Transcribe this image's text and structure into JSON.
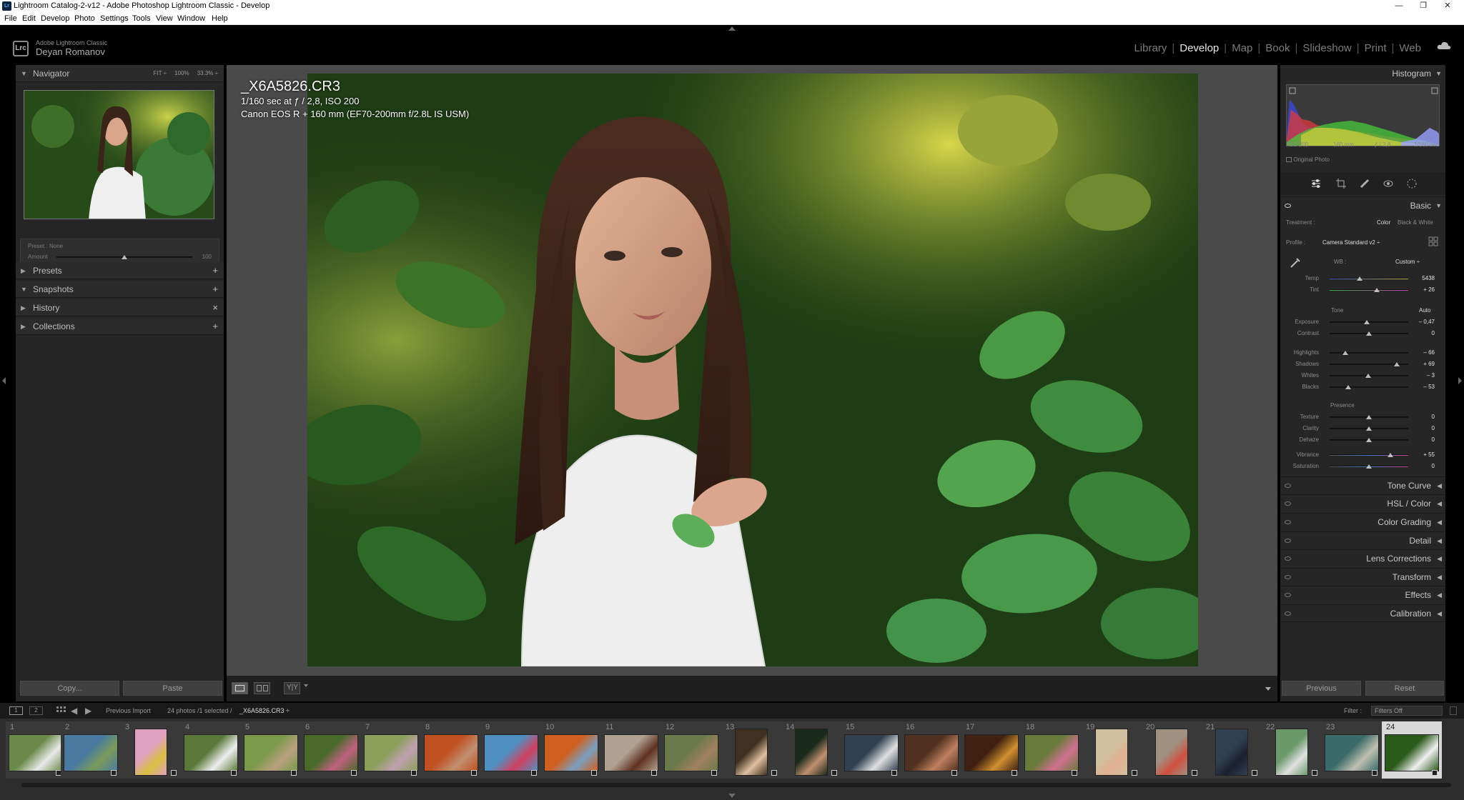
{
  "window": {
    "title": "Lightroom Catalog-2-v12 - Adobe Photoshop Lightroom Classic - Develop",
    "controls": [
      "—",
      "❐",
      "✕"
    ]
  },
  "menu": [
    "File",
    "Edit",
    "Develop",
    "Photo",
    "Settings",
    "Tools",
    "View",
    "Window",
    "Help"
  ],
  "brand": {
    "app": "Adobe Lightroom Classic",
    "user": "Deyan Romanov",
    "logo": "Lrc"
  },
  "modules": [
    "Library",
    "Develop",
    "Map",
    "Book",
    "Slideshow",
    "Print",
    "Web"
  ],
  "active_module": "Develop",
  "left": {
    "navigator": {
      "label": "Navigator",
      "fit": "FIT ÷",
      "z1": "100%",
      "z2": "33.3% ÷"
    },
    "preset_row": {
      "preset_label": "Preset :",
      "preset_value": "None",
      "amount_label": "Amount",
      "amount_value": "100"
    },
    "sections": [
      {
        "label": "Presets",
        "action": "+"
      },
      {
        "label": "Snapshots",
        "action": "+"
      },
      {
        "label": "History",
        "action": "×"
      },
      {
        "label": "Collections",
        "action": "+"
      }
    ],
    "copy": "Copy...",
    "paste": "Paste"
  },
  "photo_info": {
    "filename": "_X6A5826.CR3",
    "exposure": "1/160 sec at ƒ / 2,8, ISO 200",
    "camera": "Canon EOS R + 160 mm (EF70-200mm f/2.8L IS USM)"
  },
  "right": {
    "histogram": {
      "label": "Histogram",
      "iso": "ISO 200",
      "focal": "160 mm",
      "aperture": "ƒ / 2,8",
      "shutter": "1/160 sec",
      "original": "Original Photo"
    },
    "basic": {
      "label": "Basic",
      "treatment_label": "Treatment :",
      "treatment_color": "Color",
      "treatment_bw": "Black & White",
      "profile_label": "Profile :",
      "profile_value": "Camera Standard v2 ÷",
      "wb_label": "WB :",
      "wb_value": "Custom ÷",
      "tone_label": "Tone",
      "auto_label": "Auto",
      "presence_label": "Presence",
      "sliders": [
        {
          "label": "Temp",
          "value": "5438",
          "pos": 0.38
        },
        {
          "label": "Tint",
          "value": "+ 26",
          "pos": 0.6
        },
        {
          "label": "Exposure",
          "value": "– 0,47",
          "pos": 0.47
        },
        {
          "label": "Contrast",
          "value": "0",
          "pos": 0.5
        },
        {
          "label": "Highlights",
          "value": "– 66",
          "pos": 0.2
        },
        {
          "label": "Shadows",
          "value": "+ 69",
          "pos": 0.85
        },
        {
          "label": "Whites",
          "value": "– 3",
          "pos": 0.49
        },
        {
          "label": "Blacks",
          "value": "– 53",
          "pos": 0.24
        },
        {
          "label": "Texture",
          "value": "0",
          "pos": 0.5
        },
        {
          "label": "Clarity",
          "value": "0",
          "pos": 0.5
        },
        {
          "label": "Dehaze",
          "value": "0",
          "pos": 0.5
        },
        {
          "label": "Vibrance",
          "value": "+ 55",
          "pos": 0.77
        },
        {
          "label": "Saturation",
          "value": "0",
          "pos": 0.5
        }
      ]
    },
    "sections": [
      "Tone Curve",
      "HSL / Color",
      "Color Grading",
      "Detail",
      "Lens Corrections",
      "Transform",
      "Effects",
      "Calibration"
    ],
    "previous": "Previous",
    "reset": "Reset"
  },
  "filmstrip": {
    "source": "Previous Import",
    "count": "24 photos /1 selected /",
    "current": "_X6A5826.CR3 ÷",
    "filter_label": "Filter :",
    "filter_value": "Filters Off",
    "screens": [
      "1",
      "2"
    ],
    "numbers": [
      "1",
      "2",
      "3",
      "4",
      "5",
      "6",
      "7",
      "8",
      "9",
      "10",
      "11",
      "12",
      "13",
      "14",
      "15",
      "16",
      "17",
      "18",
      "19",
      "20",
      "21",
      "22",
      "23",
      "24"
    ],
    "selected_index": 23
  },
  "colors": {
    "accent": "#e8e8e8",
    "panel": "#262626",
    "canvas": "#4a4a4a"
  }
}
